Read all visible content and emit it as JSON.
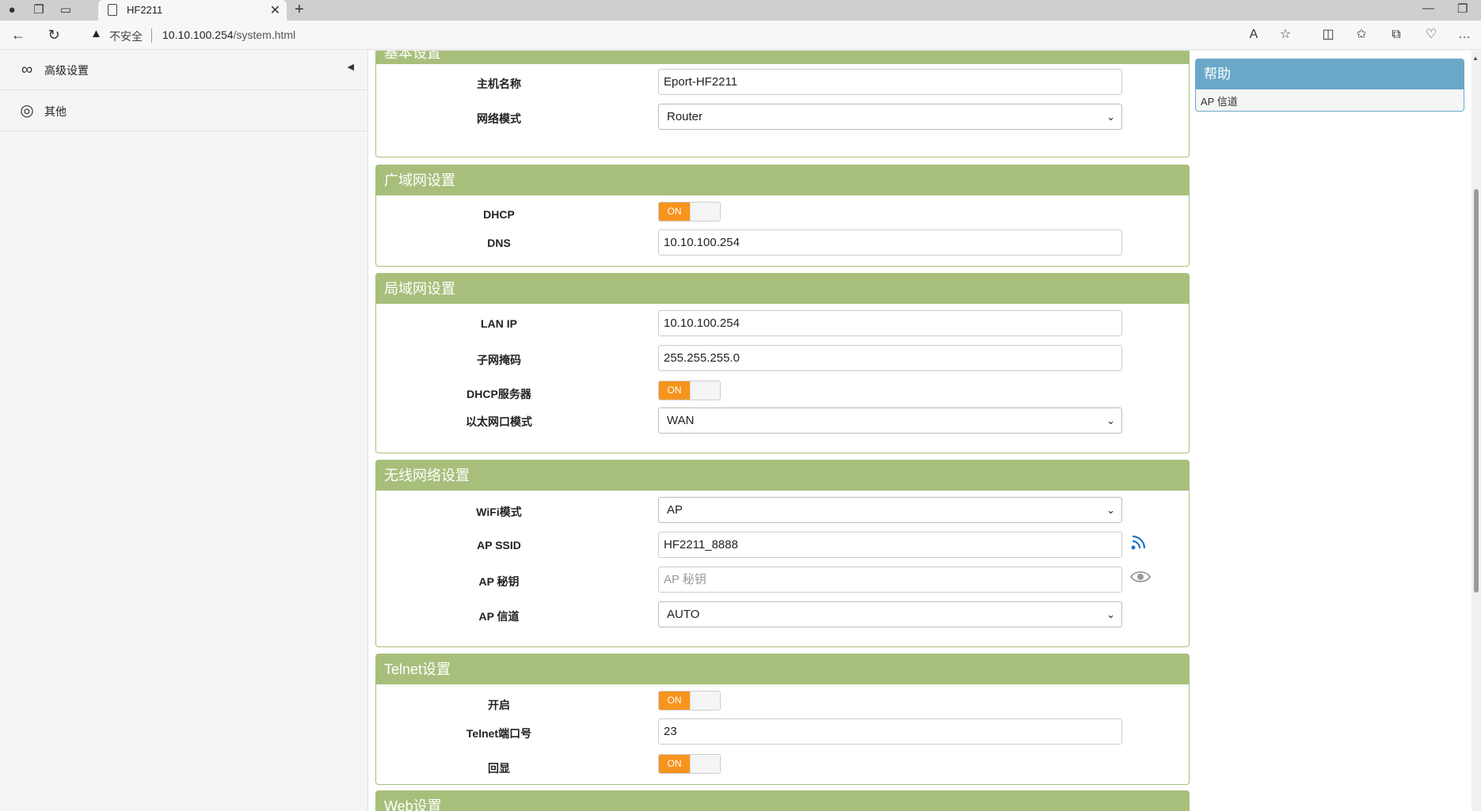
{
  "browser": {
    "tab_title": "HF2211",
    "insecure_label": "不安全",
    "url_host": "10.10.100.254",
    "url_path": "/system.html"
  },
  "sidebar": {
    "items": [
      {
        "label": "高级设置",
        "icon": "infinity-icon"
      },
      {
        "label": "其他",
        "icon": "globe-icon"
      }
    ]
  },
  "sections": {
    "basic": {
      "title": "基本设置",
      "hostname_label": "主机名称",
      "hostname_value": "Eport-HF2211",
      "netmode_label": "网络模式",
      "netmode_value": "Router"
    },
    "wan": {
      "title": "广域网设置",
      "dhcp_label": "DHCP",
      "dhcp_state": "ON",
      "dns_label": "DNS",
      "dns_value": "10.10.100.254"
    },
    "lan": {
      "title": "局域网设置",
      "ip_label": "LAN IP",
      "ip_value": "10.10.100.254",
      "mask_label": "子网掩码",
      "mask_value": "255.255.255.0",
      "dhcp_server_label": "DHCP服务器",
      "dhcp_server_state": "ON",
      "eth_mode_label": "以太网口模式",
      "eth_mode_value": "WAN"
    },
    "wireless": {
      "title": "无线网络设置",
      "wifi_mode_label": "WiFi模式",
      "wifi_mode_value": "AP",
      "ssid_label": "AP SSID",
      "ssid_value": "HF2211_8888",
      "key_label": "AP 秘钥",
      "key_placeholder": "AP 秘钥",
      "channel_label": "AP 信道",
      "channel_value": "AUTO"
    },
    "telnet": {
      "title": "Telnet设置",
      "enable_label": "开启",
      "enable_state": "ON",
      "port_label": "Telnet端口号",
      "port_value": "23",
      "echo_label": "回显",
      "echo_state": "ON"
    },
    "web": {
      "title": "Web设置"
    }
  },
  "help": {
    "title": "帮助",
    "body": "AP 信道"
  },
  "colors": {
    "panel_header": "#a8bf7c",
    "help_header": "#6aa8c8",
    "toggle_on": "#f7941d"
  }
}
